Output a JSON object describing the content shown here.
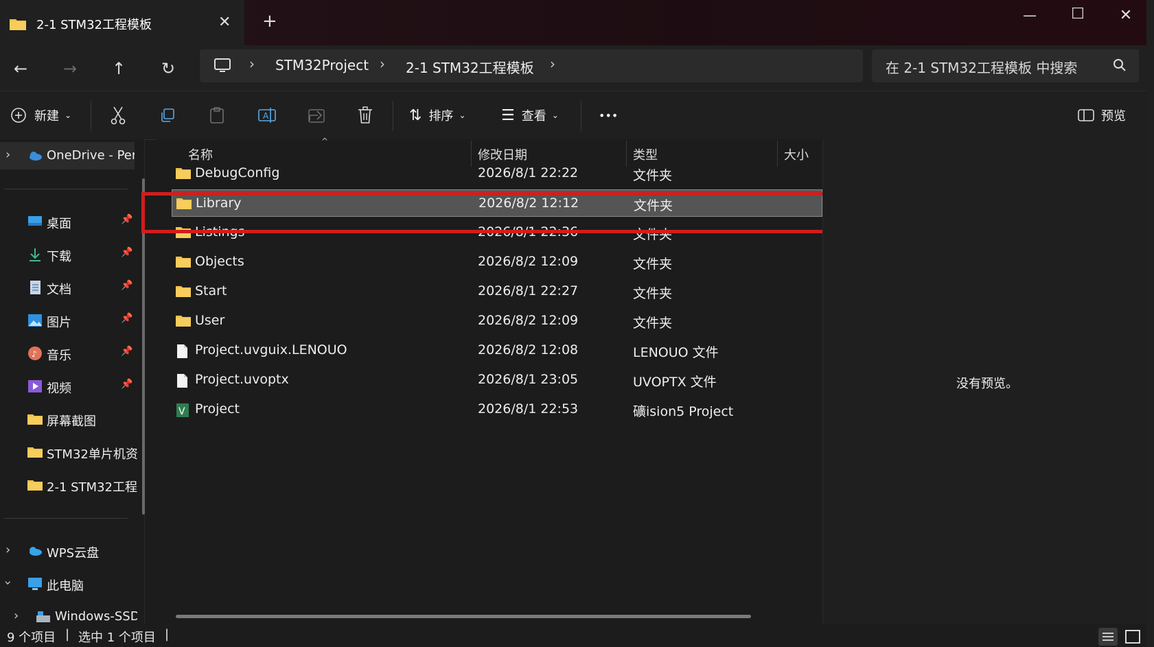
{
  "tab": {
    "title": "2-1 STM32工程模板",
    "close_glyph": "✕",
    "new_glyph": "+"
  },
  "window": {
    "minimize_glyph": "—",
    "maximize_glyph": "☐",
    "close_glyph": "✕"
  },
  "nav": {
    "back": "←",
    "forward": "→",
    "up": "↑",
    "refresh": "↻"
  },
  "address": {
    "crumbs": [
      "STM32Project",
      "2-1 STM32工程模板"
    ],
    "sep": "›"
  },
  "search": {
    "placeholder": "在 2-1 STM32工程模板 中搜索"
  },
  "toolbar": {
    "new_label": "新建",
    "sort_label": "排序",
    "view_label": "查看",
    "more_label": "•••",
    "preview_label": "预览"
  },
  "sidebar": {
    "onedrive": "OneDrive - Per",
    "items": [
      {
        "label": "桌面",
        "icon": "desktop-icon"
      },
      {
        "label": "下载",
        "icon": "download-icon"
      },
      {
        "label": "文档",
        "icon": "document-icon"
      },
      {
        "label": "图片",
        "icon": "picture-icon"
      },
      {
        "label": "音乐",
        "icon": "music-icon"
      },
      {
        "label": "视频",
        "icon": "video-icon"
      },
      {
        "label": "屏幕截图",
        "icon": "folder-icon"
      },
      {
        "label": "STM32单片机资",
        "icon": "folder-icon"
      },
      {
        "label": "2-1 STM32工程",
        "icon": "folder-icon"
      }
    ],
    "wps": "WPS云盘",
    "pc": "此电脑",
    "drive": "Windows-SSD"
  },
  "columns": {
    "name": "名称",
    "date": "修改日期",
    "type": "类型",
    "size": "大小"
  },
  "files": [
    {
      "name": "DebugConfig",
      "date": "2026/8/1 22:22",
      "type": "文件夹",
      "icon": "folder-icon"
    },
    {
      "name": "Library",
      "date": "2026/8/2 12:12",
      "type": "文件夹",
      "icon": "folder-icon",
      "selected": true
    },
    {
      "name": "Listings",
      "date": "2026/8/1 22:36",
      "type": "文件夹",
      "icon": "folder-icon"
    },
    {
      "name": "Objects",
      "date": "2026/8/2 12:09",
      "type": "文件夹",
      "icon": "folder-icon"
    },
    {
      "name": "Start",
      "date": "2026/8/1 22:27",
      "type": "文件夹",
      "icon": "folder-icon"
    },
    {
      "name": "User",
      "date": "2026/8/2 12:09",
      "type": "文件夹",
      "icon": "folder-icon"
    },
    {
      "name": "Project.uvguix.LENOUO",
      "date": "2026/8/2 12:08",
      "type": "LENOUO 文件",
      "icon": "file-icon"
    },
    {
      "name": "Project.uvoptx",
      "date": "2026/8/1 23:05",
      "type": "UVOPTX 文件",
      "icon": "file-icon"
    },
    {
      "name": "Project",
      "date": "2026/8/1 22:53",
      "type": "礦ision5 Project",
      "icon": "keil-project-icon"
    }
  ],
  "preview": {
    "empty_text": "没有预览。"
  },
  "status": {
    "count": "9 个项目",
    "sep": "|",
    "selected": "选中 1 个项目",
    "sep2": "|"
  },
  "colors": {
    "selection_outline": "#d21d1d",
    "folder": "#f5c04a",
    "selected_row": "#555555"
  }
}
